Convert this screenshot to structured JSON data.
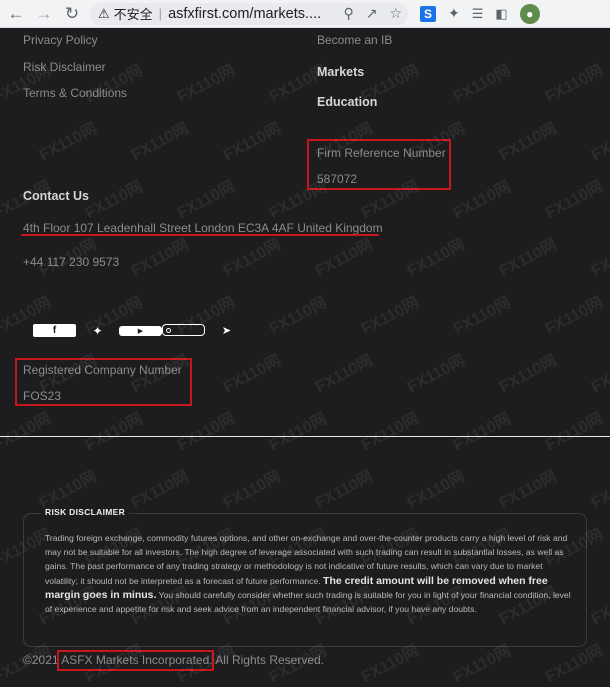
{
  "browser": {
    "security_label": "不安全",
    "separator": "|",
    "url": "asfxfirst.com/markets....",
    "extension_s": "S"
  },
  "footer": {
    "links_left": [
      "Privacy Policy",
      "Risk Disclaimer",
      "Terms & Conditions"
    ],
    "become_ib": "Become an IB",
    "markets": "Markets",
    "education": "Education",
    "firm_ref_label": "Firm Reference Number",
    "firm_ref_value": "587072",
    "contact_heading": "Contact Us",
    "address": "4th Floor 107 Leadenhall Street London EC3A 4AF United Kingdom",
    "phone": "+44 117 230 9573",
    "social": [
      "facebook-icon",
      "twitter-icon",
      "youtube-icon",
      "instagram-icon",
      "telegram-icon"
    ],
    "reg_company_label": "Registered Company Number",
    "reg_company_value": "FOS23"
  },
  "risk": {
    "title": "RISK DISCLAIMER",
    "body_1": "Trading foreign exchange, commodity futures options, and other on-exchange and over-the-counter products carry a high level of risk and may not be suitable for all investors. The high degree of leverage associated with such trading can result in substantial losses, as well as gains. The past performance of any trading strategy or methodology is not indicative of future results, which can vary due to market volatility; it should not be interpreted as a forecast of future performance.",
    "body_bold": "The credit amount will be removed when free margin goes in minus.",
    "body_2": "You should carefully consider whether such trading is suitable for you in light of your financial condition, level of experience and appetite for risk and seek advice from an independent financial advisor, if you have any doubts."
  },
  "copyright": {
    "prefix": "©2021",
    "company": "ASFX Markets Incorporated.",
    "suffix": "All Rights Reserved."
  },
  "watermark": "FX110网",
  "colors": {
    "background": "#1d1d1f",
    "annotation": "#c4161c",
    "heading": "#d6d6d6",
    "text": "#8c8c8c"
  }
}
